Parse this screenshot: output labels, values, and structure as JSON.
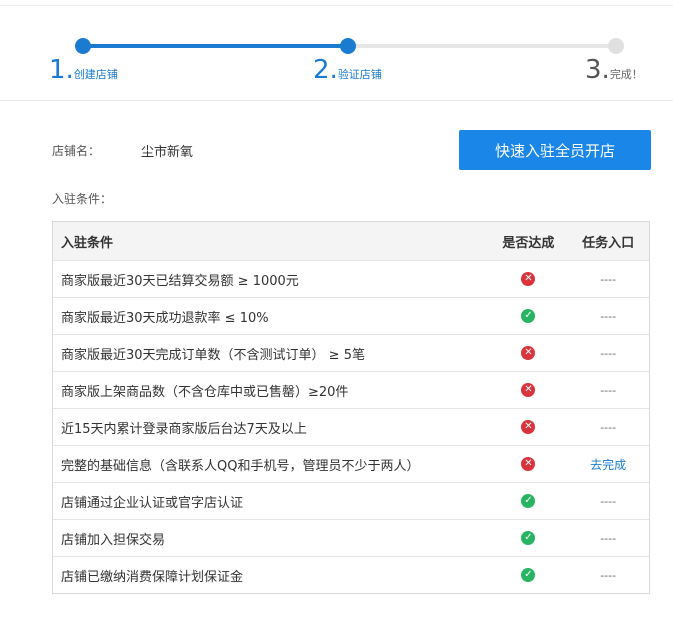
{
  "stepper": {
    "steps": [
      {
        "num": "1.",
        "label": "创建店铺",
        "state": "active"
      },
      {
        "num": "2.",
        "label": "验证店铺",
        "state": "active"
      },
      {
        "num": "3.",
        "label": "完成！",
        "state": "inactive"
      }
    ]
  },
  "store": {
    "name_label": "店铺名：",
    "name_value": "尘市新氧",
    "conditions_label": "入驻条件：",
    "cta_label": "快速入驻全员开店"
  },
  "table": {
    "headers": [
      "入驻条件",
      "是否达成",
      "任务入口"
    ],
    "rows": [
      {
        "condition": "商家版最近30天已结算交易额 ≥ 1000元",
        "status": "fail",
        "entry": "----"
      },
      {
        "condition": "商家版最近30天成功退款率 ≤ 10%",
        "status": "ok",
        "entry": "----"
      },
      {
        "condition": "商家版最近30天完成订单数（不含测试订单） ≥ 5笔",
        "status": "fail",
        "entry": "----"
      },
      {
        "condition": "商家版上架商品数（不含仓库中或已售罄）≥20件",
        "status": "fail",
        "entry": "----"
      },
      {
        "condition": "近15天内累计登录商家版后台达7天及以上",
        "status": "fail",
        "entry": "----"
      },
      {
        "condition": "完整的基础信息（含联系人QQ和手机号，管理员不少于两人）",
        "status": "fail",
        "entry": "去完成"
      },
      {
        "condition": "店铺通过企业认证或官字店认证",
        "status": "ok",
        "entry": "----"
      },
      {
        "condition": "店铺加入担保交易",
        "status": "ok",
        "entry": "----"
      },
      {
        "condition": "店铺已缴纳消费保障计划保证金",
        "status": "ok",
        "entry": "----"
      }
    ]
  },
  "icons": {
    "fail": "close-circle-icon",
    "ok": "check-circle-icon"
  },
  "colors": {
    "accent": "#1a7bd0",
    "button": "#1a87e8",
    "fail": "#d9333b",
    "ok": "#28b463"
  }
}
